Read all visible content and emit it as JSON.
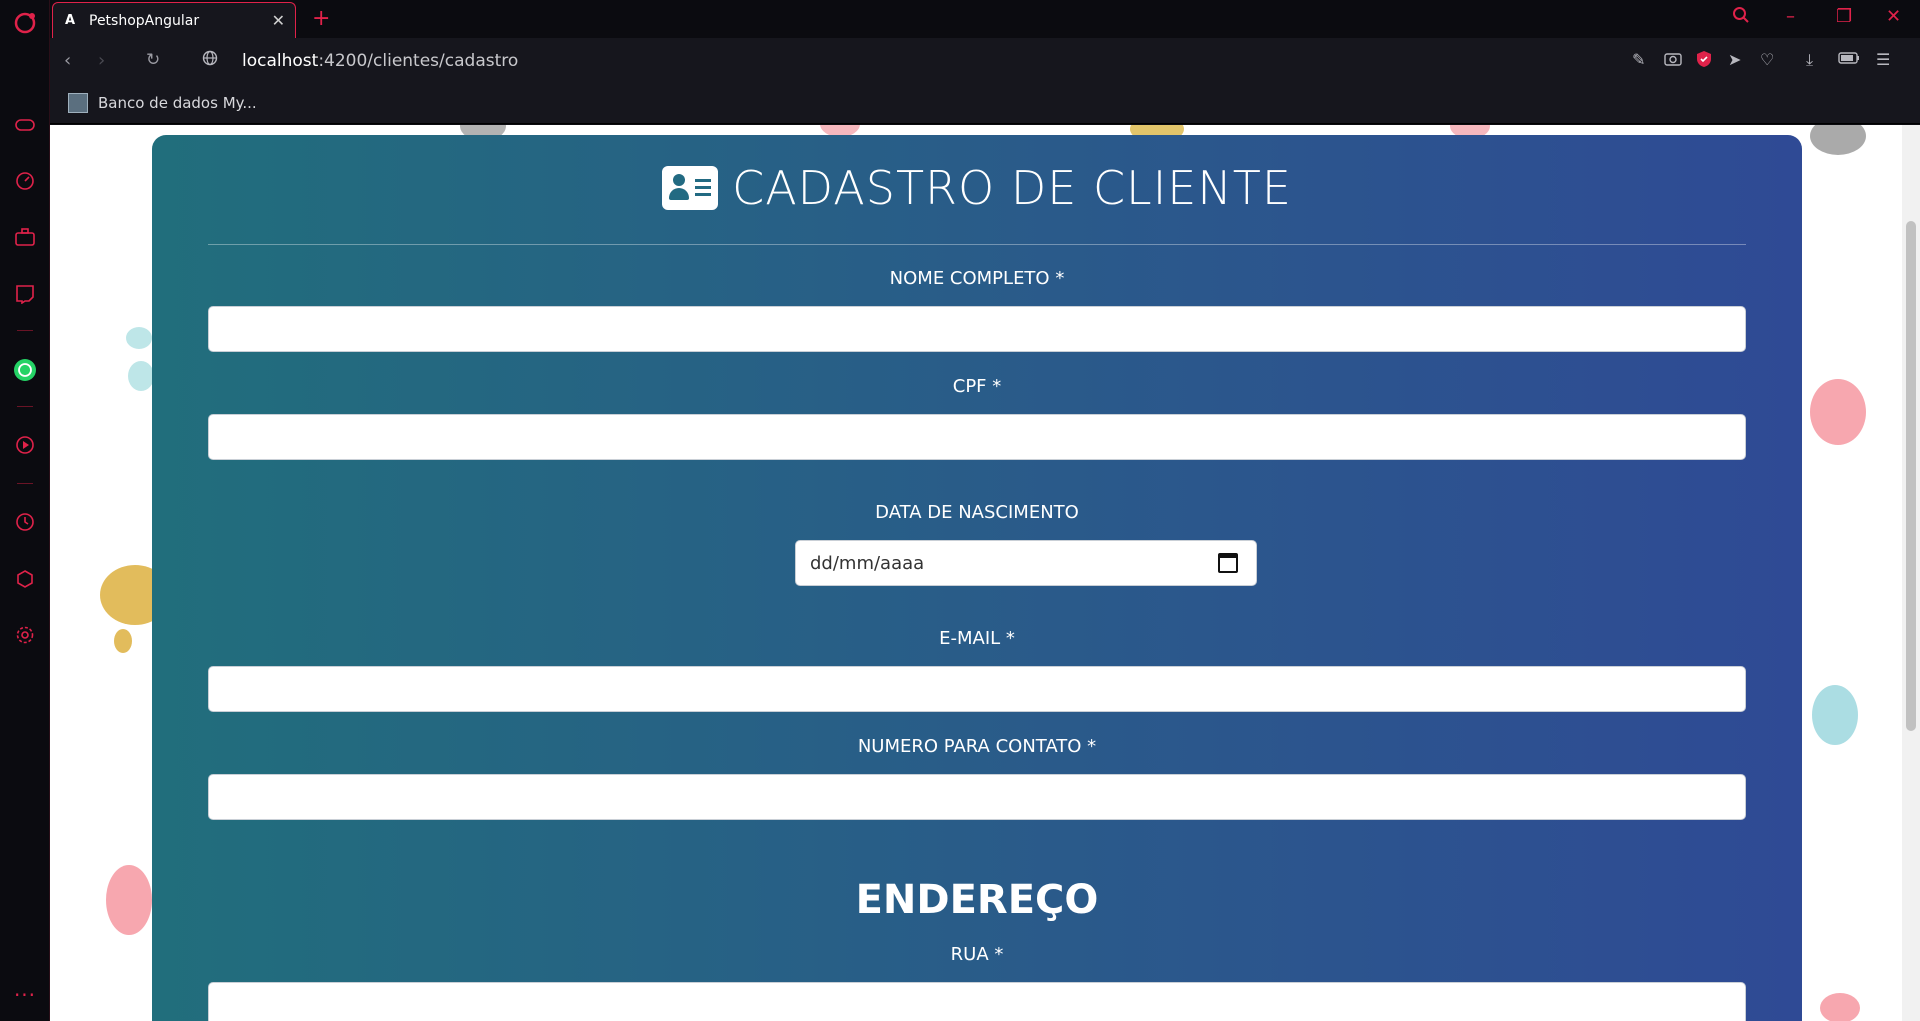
{
  "browser": {
    "tab": {
      "title": "PetshopAngular"
    },
    "address": {
      "host": "localhost",
      "path": ":4200/clientes/cadastro"
    },
    "bookmarks": [
      {
        "label": "Banco de dados My..."
      }
    ]
  },
  "icons": {
    "sidebar": [
      "opera-logo-icon",
      "gamepad-icon",
      "speed-dial-icon",
      "briefcase-icon",
      "twitch-icon",
      "whatsapp-icon",
      "player-icon",
      "history-icon",
      "cube-icon",
      "settings-icon",
      "more-icon"
    ],
    "toolbar": [
      "snapshot-edit-icon",
      "camera-icon",
      "shield-icon",
      "send-icon",
      "heart-icon",
      "download-icon",
      "battery-icon",
      "easy-setup-icon"
    ]
  },
  "colors": {
    "accent": "#e0224a",
    "card_start": "#216e7c",
    "card_end": "#2f4a95"
  },
  "form": {
    "title": "CADASTRO DE CLIENTE",
    "fields": {
      "nome": {
        "label": "NOME COMPLETO *",
        "value": ""
      },
      "cpf": {
        "label": "CPF *",
        "value": ""
      },
      "nascimento": {
        "label": "DATA DE NASCIMENTO",
        "placeholder": "dd/mm/aaaa"
      },
      "email": {
        "label": "E-MAIL *",
        "value": ""
      },
      "contato": {
        "label": "NUMERO PARA CONTATO *",
        "value": ""
      }
    },
    "address_section": {
      "title": "ENDEREÇO",
      "rua": {
        "label": "RUA *",
        "value": ""
      }
    }
  }
}
